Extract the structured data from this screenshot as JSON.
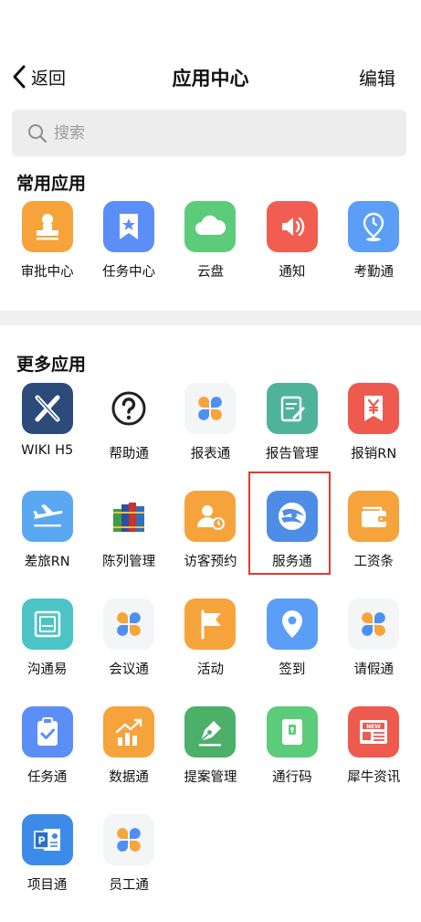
{
  "nav": {
    "back_label": "返回",
    "title": "应用中心",
    "edit_label": "编辑"
  },
  "search": {
    "placeholder": "搜索"
  },
  "sections": {
    "common": {
      "title": "常用应用",
      "apps": [
        {
          "label": "审批中心",
          "icon": "stamp-icon",
          "color": "#f6a33c"
        },
        {
          "label": "任务中心",
          "icon": "bookmark-star-icon",
          "color": "#5b8ef7"
        },
        {
          "label": "云盘",
          "icon": "cloud-icon",
          "color": "#5ccc7a"
        },
        {
          "label": "通知",
          "icon": "speaker-icon",
          "color": "#f25d52"
        },
        {
          "label": "考勤通",
          "icon": "location-clock-icon",
          "color": "#5b9ef7"
        }
      ]
    },
    "more": {
      "title": "更多应用",
      "apps": [
        {
          "label": "WIKI H5",
          "icon": "wiki-x-icon",
          "color": "#2c4a7a"
        },
        {
          "label": "帮助通",
          "icon": "help-question-icon",
          "color": "#ffffff"
        },
        {
          "label": "报表通",
          "icon": "clover-icon",
          "color": "#f4f5f7"
        },
        {
          "label": "报告管理",
          "icon": "report-document-icon",
          "color": "#4fb39a"
        },
        {
          "label": "报销RN",
          "icon": "yen-ribbon-icon",
          "color": "#ee5a4e"
        },
        {
          "label": "差旅RN",
          "icon": "airplane-icon",
          "color": "#5aa7f2"
        },
        {
          "label": "陈列管理",
          "icon": "books-icon",
          "color": "#ffffff"
        },
        {
          "label": "访客预约",
          "icon": "visitor-clock-icon",
          "color": "#f6a33c"
        },
        {
          "label": "服务通",
          "icon": "service-swirl-icon",
          "color": "#4e8de6"
        },
        {
          "label": "工资条",
          "icon": "wallet-icon",
          "color": "#f6a33c"
        },
        {
          "label": "沟通易",
          "icon": "chat-box-icon",
          "color": "#4cc4c6"
        },
        {
          "label": "会议通",
          "icon": "clover-icon",
          "color": "#f4f5f7"
        },
        {
          "label": "活动",
          "icon": "flag-icon",
          "color": "#f6a33c"
        },
        {
          "label": "签到",
          "icon": "map-pin-icon",
          "color": "#5b9ef7"
        },
        {
          "label": "请假通",
          "icon": "clover-icon",
          "color": "#f4f5f7"
        },
        {
          "label": "任务通",
          "icon": "clipboard-check-icon",
          "color": "#5b8ef7"
        },
        {
          "label": "数据通",
          "icon": "chart-bars-icon",
          "color": "#f6a33c"
        },
        {
          "label": "提案管理",
          "icon": "pen-nib-icon",
          "color": "#4caf6a"
        },
        {
          "label": "通行码",
          "icon": "pass-code-icon",
          "color": "#5ccc7a"
        },
        {
          "label": "犀牛资讯",
          "icon": "newspaper-icon",
          "color": "#ee5a4e"
        },
        {
          "label": "项目通",
          "icon": "presentation-icon",
          "color": "#3d8be8"
        },
        {
          "label": "员工通",
          "icon": "clover-icon",
          "color": "#f4f5f7"
        }
      ]
    }
  }
}
